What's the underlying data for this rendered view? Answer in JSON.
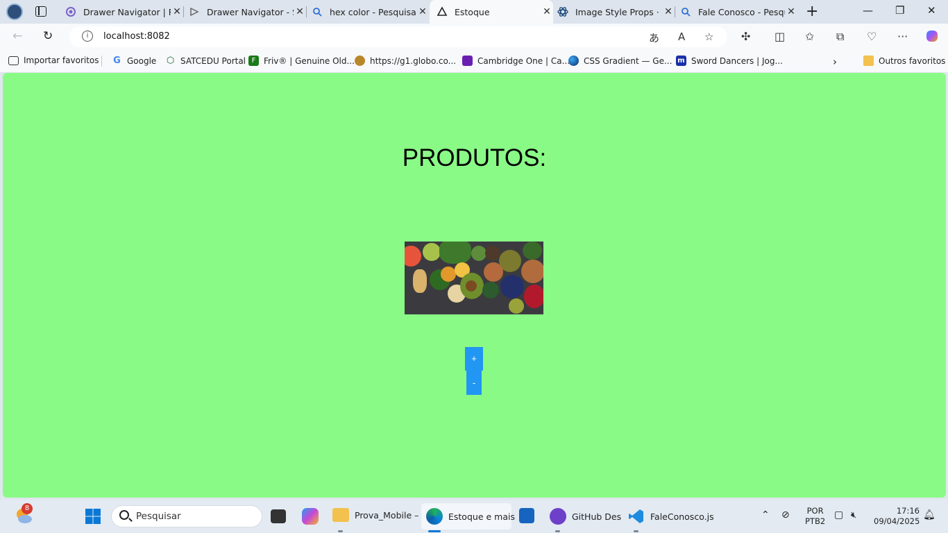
{
  "browser": {
    "tabs": [
      {
        "title": "Drawer Navigator | Re",
        "favicon": "react-icon"
      },
      {
        "title": "Drawer Navigator - Sr",
        "favicon": "snack-icon"
      },
      {
        "title": "hex color - Pesquisar",
        "favicon": "search-icon"
      },
      {
        "title": "Estoque",
        "favicon": "expo-icon",
        "active": true
      },
      {
        "title": "Image Style Props · Re",
        "favicon": "react-icon"
      },
      {
        "title": "Fale Conosco - Pesqui",
        "favicon": "search-icon"
      }
    ],
    "url": "localhost:8082",
    "bookmarks": [
      {
        "label": "Importar favoritos",
        "icon": "import-icon"
      },
      {
        "label": "Google",
        "icon": "google-icon"
      },
      {
        "label": "SATCEDU Portal",
        "icon": "satc-icon"
      },
      {
        "label": "Friv® | Genuine Old...",
        "icon": "friv-icon"
      },
      {
        "label": "https://g1.globo.co...",
        "icon": "g1-icon"
      },
      {
        "label": "Cambridge One | Ca...",
        "icon": "cambridge-icon"
      },
      {
        "label": "CSS Gradient — Ge...",
        "icon": "css-gradient-icon"
      },
      {
        "label": "Sword Dancers | Jog...",
        "icon": "m-icon"
      },
      {
        "label": "Outros favoritos",
        "icon": "folder-icon"
      }
    ]
  },
  "page": {
    "title": "PRODUTOS:",
    "image_alt": "vegetables-and-grains-photo",
    "plus_label": "+",
    "minus_label": "-",
    "background_color": "#8afa87",
    "button_color": "#2196f3"
  },
  "taskbar": {
    "weather_badge": "8",
    "search_placeholder": "Pesquisar",
    "apps": [
      {
        "label": "Prova_Mobile –",
        "icon": "folder-icon"
      },
      {
        "label": "Estoque e mais",
        "icon": "edge-icon"
      },
      {
        "label": "",
        "icon": "store-icon"
      },
      {
        "label": "GitHub Des",
        "icon": "github-icon"
      },
      {
        "label": "FaleConosco.js",
        "icon": "vscode-icon"
      }
    ],
    "language": "POR",
    "layout": "PTB2",
    "time": "17:16",
    "date": "09/04/2025"
  }
}
